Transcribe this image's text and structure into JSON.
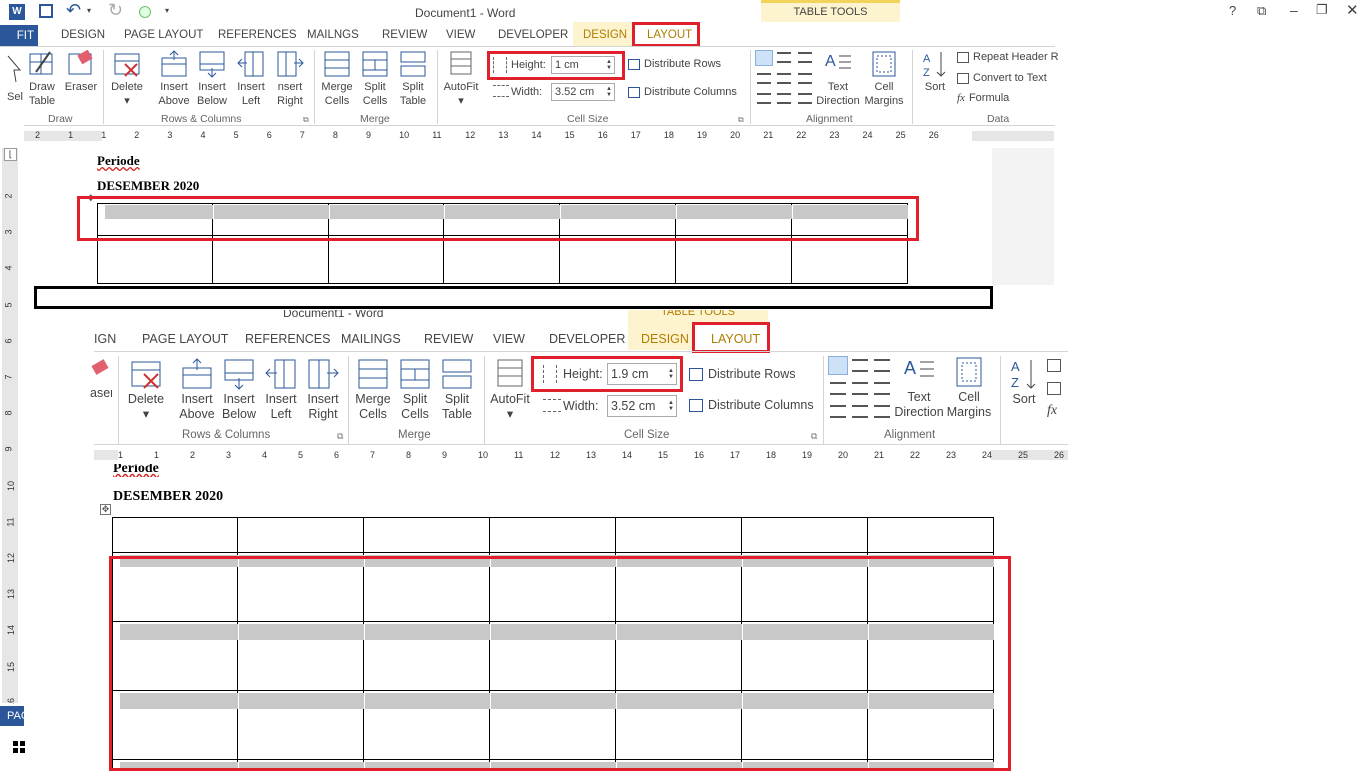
{
  "top": {
    "title": "Document1 - Word",
    "table_tools": "TABLE TOOLS",
    "tabs": [
      "FIT",
      "DESIGN",
      "PAGE LAYOUT",
      "REFERENCES",
      "MAILNGS",
      "REVIEW",
      "VIEW",
      "DEVELOPER",
      "DESIGN",
      "LAYOUT"
    ],
    "buttons": {
      "select": "Sel",
      "draw_table": [
        "Draw",
        "Table"
      ],
      "eraser": "Eraser",
      "delete": "Delete",
      "insert_above": [
        "Insert",
        "Above"
      ],
      "insert_below": [
        "Insert",
        "Below"
      ],
      "insert_left": [
        "Insert",
        "Left"
      ],
      "insert_right": [
        "nsert",
        "Right"
      ],
      "merge_cells": [
        "Merge",
        "Cells"
      ],
      "split_cells": [
        "Split",
        "Cells"
      ],
      "split_table": [
        "Split",
        "Table"
      ],
      "autofit": "AutoFit",
      "distribute_rows": "Distribute Rows",
      "distribute_columns": "Distribute Columns",
      "text_direction": [
        "Text",
        "Direction"
      ],
      "cell_margins": [
        "Cell",
        "Margins"
      ],
      "sort": "Sort",
      "repeat_header": "Repeat Header R",
      "convert_to_text": "Convert to Text",
      "formula": "Formula"
    },
    "height_label": "Height:",
    "height_value": "1 cm",
    "width_label": "Width:",
    "width_value": "3.52 cm",
    "groups": [
      "Draw",
      "Rows & Columns",
      "Merge",
      "Cell Size",
      "Alignment",
      "Data"
    ],
    "ruler": [
      "2",
      "1",
      "1",
      "2",
      "3",
      "4",
      "5",
      "6",
      "7",
      "8",
      "9",
      "10",
      "11",
      "12",
      "13",
      "14",
      "15",
      "16",
      "17",
      "18",
      "19",
      "20",
      "21",
      "22",
      "23",
      "24",
      "25",
      "26"
    ],
    "vruler": [
      "2",
      "3",
      "4",
      "5",
      "6",
      "7",
      "8",
      "9",
      "10",
      "11",
      "12",
      "13",
      "14",
      "15",
      "16"
    ],
    "doc": {
      "periode": "Periode",
      "month": "DESEMBER 2020"
    }
  },
  "bottom": {
    "title": "Document1 - Word",
    "table_tools": "TABLE TOOLS",
    "tabs": [
      "IGN",
      "PAGE LAYOUT",
      "REFERENCES",
      "MAILINGS",
      "REVIEW",
      "VIEW",
      "DEVELOPER",
      "DESIGN",
      "LAYOUT"
    ],
    "buttons": {
      "eraser": "aser",
      "delete": "Delete",
      "insert_above": [
        "Insert",
        "Above"
      ],
      "insert_below": [
        "Insert",
        "Below"
      ],
      "insert_left": [
        "Insert",
        "Left"
      ],
      "insert_right": [
        "Insert",
        "Right"
      ],
      "merge_cells": [
        "Merge",
        "Cells"
      ],
      "split_cells": [
        "Split",
        "Cells"
      ],
      "split_table": [
        "Split",
        "Table"
      ],
      "autofit": "AutoFit",
      "distribute_rows": "Distribute Rows",
      "distribute_columns": "Distribute Columns",
      "text_direction": [
        "Text",
        "Direction"
      ],
      "cell_margins": [
        "Cell",
        "Margins"
      ],
      "sort": "Sort"
    },
    "height_label": "Height:",
    "height_value": "1.9 cm",
    "width_label": "Width:",
    "width_value": "3.52 cm",
    "groups": [
      "Rows & Columns",
      "Merge",
      "Cell Size",
      "Alignment"
    ],
    "ruler": [
      "1",
      "1",
      "2",
      "3",
      "4",
      "5",
      "6",
      "7",
      "8",
      "9",
      "10",
      "11",
      "12",
      "13",
      "14",
      "15",
      "16",
      "17",
      "18",
      "19",
      "20",
      "21",
      "22",
      "23",
      "24",
      "25",
      "26"
    ],
    "doc": {
      "periode": "Periode",
      "month": "DESEMBER 2020"
    }
  },
  "taskbar": {
    "label": "PAG"
  },
  "window_controls": [
    "?",
    "⧉",
    "–",
    "❐"
  ]
}
